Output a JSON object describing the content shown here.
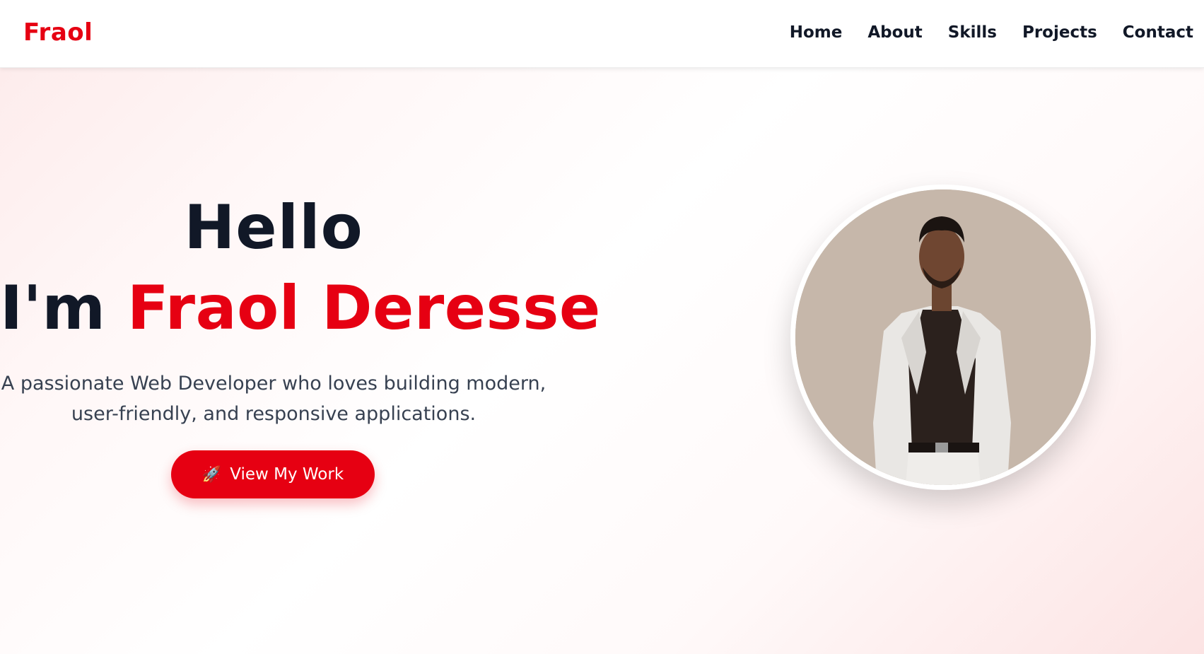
{
  "header": {
    "logo": "Fraol",
    "nav": [
      {
        "label": "Home"
      },
      {
        "label": "About"
      },
      {
        "label": "Skills"
      },
      {
        "label": "Projects"
      },
      {
        "label": "Contact"
      }
    ]
  },
  "hero": {
    "greeting": "Hello",
    "intro_prefix": "I'm",
    "name": "Fraol Deresse",
    "tagline_line1": "A passionate Web Developer who loves building modern,",
    "tagline_line2": "user-friendly, and responsive applications.",
    "cta_label": "View My Work",
    "cta_icon": "rocket-icon",
    "portrait_alt": "profile photo"
  },
  "colors": {
    "accent": "#e60012",
    "text_dark": "#111827",
    "text_muted": "#374151"
  }
}
